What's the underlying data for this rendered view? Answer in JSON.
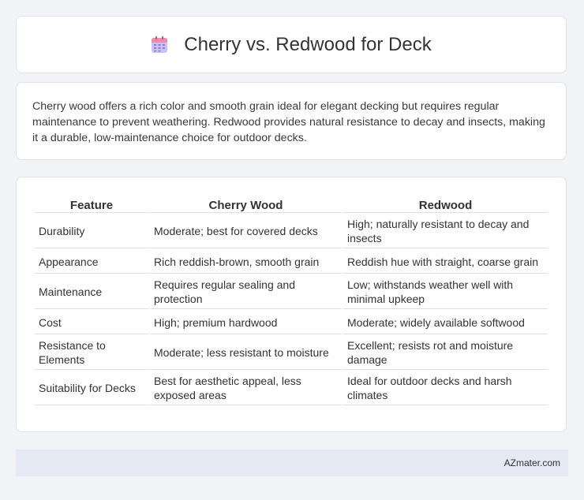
{
  "header": {
    "title": "Cherry vs. Redwood for Deck",
    "icon": "calendar-icon"
  },
  "summary": {
    "text": "Cherry wood offers a rich color and smooth grain ideal for elegant decking but requires regular maintenance to prevent weathering. Redwood provides natural resistance to decay and insects, making it a durable, low-maintenance choice for outdoor decks."
  },
  "table": {
    "headers": [
      "Feature",
      "Cherry Wood",
      "Redwood"
    ],
    "rows": [
      [
        "Durability",
        "Moderate; best for covered decks",
        "High; naturally resistant to decay and insects"
      ],
      [
        "Appearance",
        "Rich reddish-brown, smooth grain",
        "Reddish hue with straight, coarse grain"
      ],
      [
        "Maintenance",
        "Requires regular sealing and protection",
        "Low; withstands weather well with minimal upkeep"
      ],
      [
        "Cost",
        "High; premium hardwood",
        "Moderate; widely available softwood"
      ],
      [
        "Resistance to Elements",
        "Moderate; less resistant to moisture",
        "Excellent; resists rot and moisture damage"
      ],
      [
        "Suitability for Decks",
        "Best for aesthetic appeal, less exposed areas",
        "Ideal for outdoor decks and harsh climates"
      ]
    ]
  },
  "footer": {
    "brand": "AZmater.com"
  },
  "colors": {
    "background": "#f1f3f6",
    "card": "#ffffff",
    "footer": "#e4e9f3",
    "icon_header": "#f08aa8",
    "icon_body": "#b9a6e6"
  }
}
